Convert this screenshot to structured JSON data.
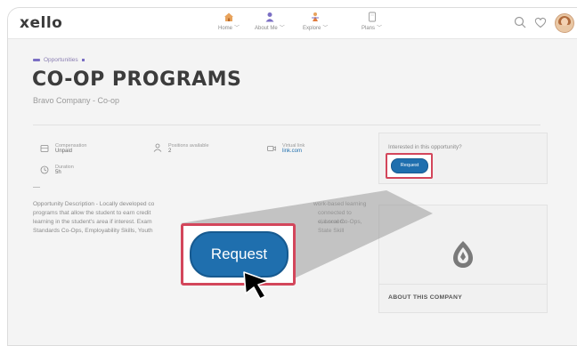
{
  "app": {
    "logo_text": "xello"
  },
  "nav": {
    "items": [
      {
        "label": "Home",
        "icon": "home-icon",
        "color": "#e07a3c"
      },
      {
        "label": "About Me",
        "icon": "person-icon",
        "color": "#7b6fc4"
      },
      {
        "label": "Explore",
        "icon": "explorer-icon",
        "color": "#e07a3c"
      },
      {
        "label": "Plans",
        "icon": "plans-icon",
        "color": "#9a9a9a"
      }
    ],
    "actions": [
      "search-icon",
      "heart-icon",
      "avatar"
    ]
  },
  "breadcrumb": {
    "label": "Opportunities"
  },
  "header": {
    "title": "CO-OP PROGRAMS",
    "subtitle": "Bravo Company - Co-op"
  },
  "details": {
    "compensation": {
      "label": "Compensation",
      "value": "Unpaid"
    },
    "positions": {
      "label": "Positions available",
      "value": "2"
    },
    "virtual": {
      "label": "Virtual link",
      "value": "link.com"
    },
    "duration": {
      "label": "Duration",
      "value": "5h"
    }
  },
  "description": {
    "left": "Opportunity Description - Locally developed co",
    "left_2": "programs that allow the student to earn credit",
    "left_3": "learning in the student's area if interest. Exam",
    "left_4": "Standards Co-Ops, Employability Skills, Youth",
    "right": "work-based learning",
    "right_2": "connected to classroom",
    "right_3": "e, Local Co-Ops, State Skill"
  },
  "sidebar": {
    "question": "Interested in this opportunity?",
    "request_label": "Request",
    "company_heading": "ABOUT THIS COMPANY"
  },
  "zoom": {
    "request_label": "Request"
  },
  "colors": {
    "accent": "#1f6fae",
    "highlight": "#d3465b",
    "brand_purple": "#7b6fc4"
  }
}
